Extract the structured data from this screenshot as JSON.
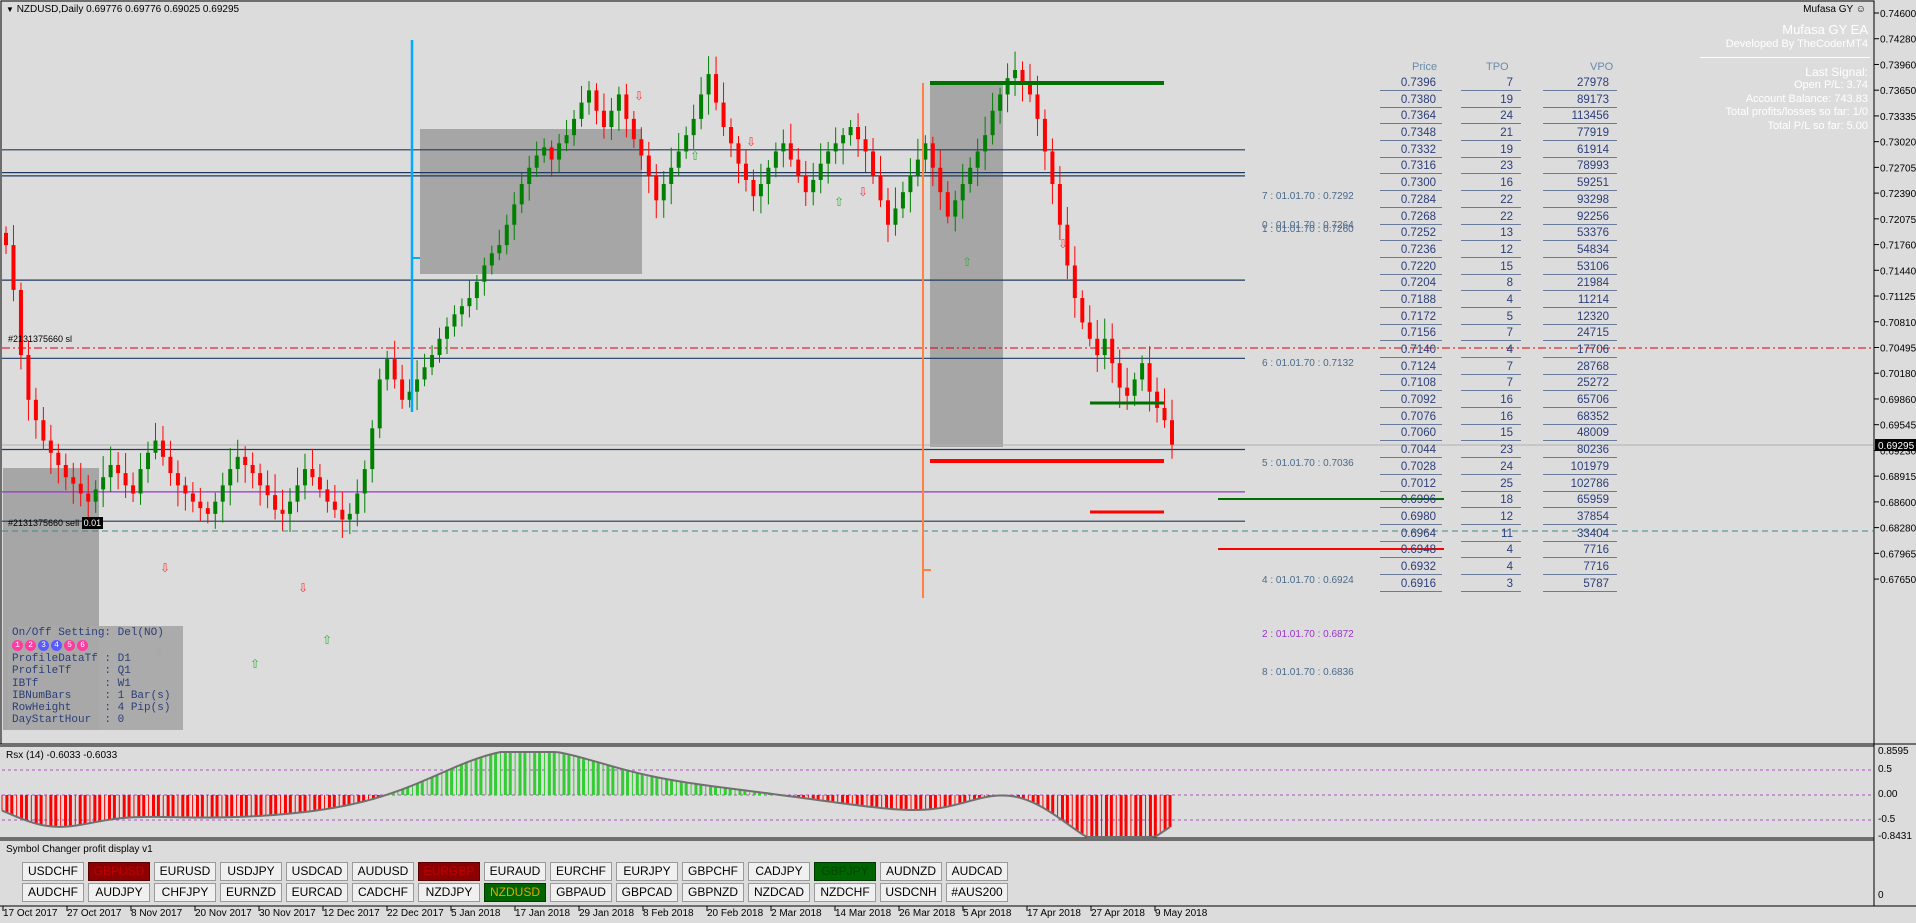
{
  "chart": {
    "header": "NZDUSD,Daily  0.69776 0.69776 0.69025 0.69295",
    "ea_name": "Mufasa GY",
    "smiley": "☺",
    "current_price": "0.69295"
  },
  "price_axis": [
    "0.74600",
    "0.74280",
    "0.73960",
    "0.73650",
    "0.73335",
    "0.73020",
    "0.72705",
    "0.72390",
    "0.72075",
    "0.71760",
    "0.71440",
    "0.71125",
    "0.70810",
    "0.70495",
    "0.70180",
    "0.69860",
    "0.69545",
    "0.69230",
    "0.68915",
    "0.68600",
    "0.68280",
    "0.67965",
    "0.67650"
  ],
  "date_axis": [
    "17 Oct 2017",
    "27 Oct 2017",
    "8 Nov 2017",
    "20 Nov 2017",
    "30 Nov 2017",
    "12 Dec 2017",
    "22 Dec 2017",
    "5 Jan 2018",
    "17 Jan 2018",
    "29 Jan 2018",
    "8 Feb 2018",
    "20 Feb 2018",
    "2 Mar 2018",
    "14 Mar 2018",
    "26 Mar 2018",
    "5 Apr 2018",
    "17 Apr 2018",
    "27 Apr 2018",
    "9 May 2018"
  ],
  "ea_panel": {
    "title": "Mufasa GY EA",
    "developer": "Developed By TheCoderMT4",
    "last_signal": "Last Signal:",
    "open_pl": "Open P/L: 3.74",
    "balance": "Account Balance: 743.83",
    "total_pl": "Total profits/losses so far: 1/0",
    "total_pips": "Total P/L so far: 5.00"
  },
  "profile_table": {
    "headers": [
      "Price",
      "TPO",
      "VPO"
    ],
    "rows": [
      [
        "0.7396",
        "7",
        "27978"
      ],
      [
        "0.7380",
        "19",
        "89173"
      ],
      [
        "0.7364",
        "24",
        "113456"
      ],
      [
        "0.7348",
        "21",
        "77919"
      ],
      [
        "0.7332",
        "19",
        "61914"
      ],
      [
        "0.7316",
        "23",
        "78993"
      ],
      [
        "0.7300",
        "16",
        "59251"
      ],
      [
        "0.7284",
        "22",
        "93298"
      ],
      [
        "0.7268",
        "22",
        "92256"
      ],
      [
        "0.7252",
        "13",
        "53376"
      ],
      [
        "0.7236",
        "12",
        "54834"
      ],
      [
        "0.7220",
        "15",
        "53106"
      ],
      [
        "0.7204",
        "8",
        "21984"
      ],
      [
        "0.7188",
        "4",
        "11214"
      ],
      [
        "0.7172",
        "5",
        "12320"
      ],
      [
        "0.7156",
        "7",
        "24715"
      ],
      [
        "0.7140",
        "4",
        "17706"
      ],
      [
        "0.7124",
        "7",
        "28768"
      ],
      [
        "0.7108",
        "7",
        "25272"
      ],
      [
        "0.7092",
        "16",
        "65706"
      ],
      [
        "0.7076",
        "16",
        "68352"
      ],
      [
        "0.7060",
        "15",
        "48009"
      ],
      [
        "0.7044",
        "23",
        "80236"
      ],
      [
        "0.7028",
        "24",
        "101979"
      ],
      [
        "0.7012",
        "25",
        "102786"
      ],
      [
        "0.6996",
        "18",
        "65959"
      ],
      [
        "0.6980",
        "12",
        "37854"
      ],
      [
        "0.6964",
        "11",
        "33404"
      ],
      [
        "0.6948",
        "4",
        "7716"
      ],
      [
        "0.6932",
        "4",
        "7716"
      ],
      [
        "0.6916",
        "3",
        "5787"
      ]
    ]
  },
  "levels": [
    {
      "label": "7 : 01.01.70 : 0.7292"
    },
    {
      "label": "0 : 01.01.70 : 0.7264"
    },
    {
      "label": "1 : 01.01.70 : 0.7260"
    },
    {
      "label": "6 : 01.01.70 : 0.7132"
    },
    {
      "label": "5 : 01.01.70 : 0.7036"
    },
    {
      "label": "4 : 01.01.70 : 0.6924"
    },
    {
      "label": "2 : 01.01.70 : 0.6872"
    },
    {
      "label": "8 : 01.01.70 : 0.6836"
    }
  ],
  "orders": {
    "sl": "#2131375660 sl",
    "sell": "#2131375660 sell",
    "sell_lot": "0.01"
  },
  "settings": {
    "onoff": "On/Off Setting: Del(NO)",
    "badges": [
      "1",
      "2",
      "3",
      "4",
      "5",
      "6"
    ],
    "lines": [
      "ProfileDataTf : D1",
      "ProfileTf     : Q1",
      "IBTf          : W1",
      "IBNumBars     : 1 Bar(s)",
      "RowHeight     : 4 Pip(s)",
      "DayStartHour  : 0"
    ]
  },
  "rsx": {
    "title": "Rsx (14) -0.6033 -0.6033",
    "axis": [
      "0.8595",
      "0.5",
      "0.00",
      "-0.5",
      "-0.8431"
    ]
  },
  "symbol_changer": {
    "title": "Symbol Changer profit display  v1",
    "axis": "0",
    "row1": [
      "USDCHF",
      "GBPUSD",
      "EURUSD",
      "USDJPY",
      "USDCAD",
      "AUDUSD",
      "EURGBP",
      "EURAUD",
      "EURCHF",
      "EURJPY",
      "GBPCHF",
      "CADJPY",
      "GBPJPY",
      "AUDNZD",
      "AUDCAD"
    ],
    "row2": [
      "AUDCHF",
      "AUDJPY",
      "CHFJPY",
      "EURNZD",
      "EURCAD",
      "CADCHF",
      "NZDJPY",
      "NZDUSD",
      "GBPAUD",
      "GBPCAD",
      "GBPNZD",
      "NZDCAD",
      "NZDCHF",
      "USDCNH",
      "#AUS200"
    ],
    "row1_state": [
      "",
      "red",
      "",
      "",
      "",
      "",
      "red",
      "",
      "",
      "",
      "",
      "",
      "green",
      "",
      ""
    ],
    "row2_state": [
      "",
      "",
      "",
      "",
      "",
      "",
      "",
      "active",
      "",
      "",
      "",
      "",
      "",
      "",
      ""
    ]
  },
  "colors": {
    "bull": "#008000",
    "bear": "#ff0000",
    "level": "#1f3a5f",
    "accent_blue": "#00aaff",
    "accent_orange": "#ff8040"
  }
}
